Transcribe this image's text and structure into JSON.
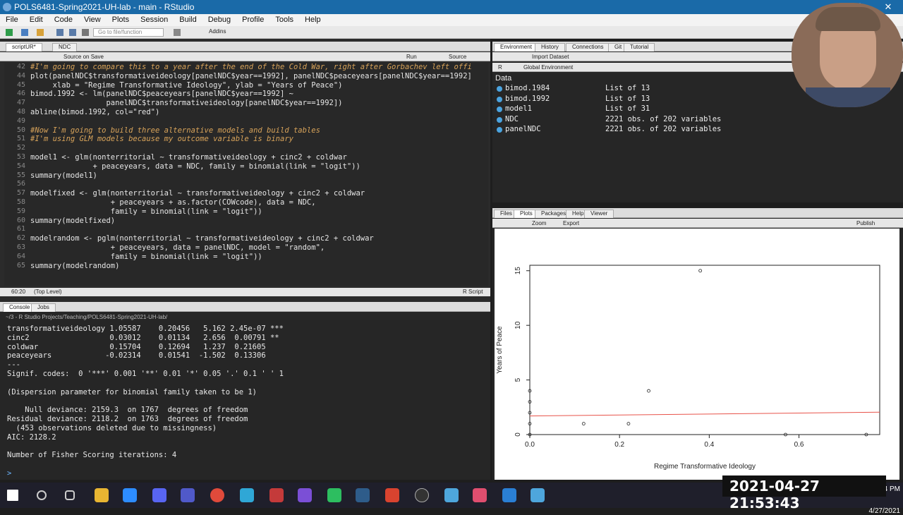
{
  "window": {
    "title": "POLS6481-Spring2021-UH-lab - main - RStudio"
  },
  "menu": [
    "File",
    "Edit",
    "Code",
    "View",
    "Plots",
    "Session",
    "Build",
    "Debug",
    "Profile",
    "Tools",
    "Help"
  ],
  "toolbar": {
    "goto_placeholder": "Go to file/function",
    "addins": "Addins"
  },
  "editor": {
    "tabs": [
      "scriptUR*",
      "NDC"
    ],
    "source_on_save": "Source on Save",
    "run": "Run",
    "source": "Source",
    "status_pos": "60:20",
    "status_scope": "(Top Level)",
    "status_type": "R Script",
    "lines": [
      {
        "n": "42",
        "text": "#I'm going to compare this to a year after the end of the Cold War, right after Gorbachev left offi",
        "comment": true
      },
      {
        "n": "44",
        "text": "plot(panelNDC$transformativeideology[panelNDC$year==1992], panelNDC$peaceyears[panelNDC$year==1992]",
        "comment": false
      },
      {
        "n": "45",
        "text": "     xlab = \"Regime Transformative Ideology\", ylab = \"Years of Peace\")",
        "comment": false
      },
      {
        "n": "46",
        "text": "bimod.1992 <- lm(panelNDC$peaceyears[panelNDC$year==1992] ~",
        "comment": false
      },
      {
        "n": "47",
        "text": "                 panelNDC$transformativeideology[panelNDC$year==1992])",
        "comment": false
      },
      {
        "n": "48",
        "text": "abline(bimod.1992, col=\"red\")",
        "comment": false
      },
      {
        "n": "49",
        "text": "",
        "comment": false
      },
      {
        "n": "50",
        "text": "#Now I'm going to build three alternative models and build tables",
        "comment": true
      },
      {
        "n": "51",
        "text": "#I'm using GLM models because my outcome variable is binary",
        "comment": true
      },
      {
        "n": "52",
        "text": "",
        "comment": false
      },
      {
        "n": "53",
        "text": "model1 <- glm(nonterritorial ~ transformativeideology + cinc2 + coldwar",
        "comment": false
      },
      {
        "n": "54",
        "text": "              + peaceyears, data = NDC, family = binomial(link = \"logit\"))",
        "comment": false
      },
      {
        "n": "55",
        "text": "summary(model1)",
        "comment": false
      },
      {
        "n": "56",
        "text": "",
        "comment": false
      },
      {
        "n": "57",
        "text": "modelfixed <- glm(nonterritorial ~ transformativeideology + cinc2 + coldwar",
        "comment": false
      },
      {
        "n": "58",
        "text": "                  + peaceyears + as.factor(COWcode), data = NDC,",
        "comment": false
      },
      {
        "n": "59",
        "text": "                  family = binomial(link = \"logit\"))",
        "comment": false
      },
      {
        "n": "60",
        "text": "summary(modelfixed)",
        "comment": false
      },
      {
        "n": "61",
        "text": "",
        "comment": false
      },
      {
        "n": "62",
        "text": "modelrandom <- pglm(nonterritorial ~ transformativeideology + cinc2 + coldwar",
        "comment": false
      },
      {
        "n": "63",
        "text": "                  + peaceyears, data = panelNDC, model = \"random\",",
        "comment": false
      },
      {
        "n": "64",
        "text": "                  family = binomial(link = \"logit\"))",
        "comment": false
      },
      {
        "n": "65",
        "text": "summary(modelrandom)",
        "comment": false
      }
    ]
  },
  "console": {
    "tabs": [
      "Console",
      "Jobs"
    ],
    "path": "~/3 - R Studio Projects/Teaching/POLS6481-Spring2021-UH-lab/",
    "lines": [
      "transformativeideology 1.05587    0.20456   5.162 2.45e-07 ***",
      "cinc2                  0.03012    0.01134   2.656  0.00791 **",
      "coldwar                0.15704    0.12694   1.237  0.21605",
      "peaceyears            -0.02314    0.01541  -1.502  0.13306",
      "---",
      "Signif. codes:  0 '***' 0.001 '**' 0.01 '*' 0.05 '.' 0.1 ' ' 1",
      "",
      "(Dispersion parameter for binomial family taken to be 1)",
      "",
      "    Null deviance: 2159.3  on 1767  degrees of freedom",
      "Residual deviance: 2118.2  on 1763  degrees of freedom",
      "  (453 observations deleted due to missingness)",
      "AIC: 2128.2",
      "",
      "Number of Fisher Scoring iterations: 4",
      "",
      ">"
    ]
  },
  "environment": {
    "tabs": [
      "Environment",
      "History",
      "Connections",
      "Git",
      "Tutorial"
    ],
    "import": "Import Dataset",
    "scope_r": "R",
    "scope": "Global Environment",
    "section": "Data",
    "rows": [
      {
        "name": "bimod.1984",
        "value": "List of  13"
      },
      {
        "name": "bimod.1992",
        "value": "List of  13"
      },
      {
        "name": "model1",
        "value": "List of  31"
      },
      {
        "name": "NDC",
        "value": "2221 obs. of 202 variables"
      },
      {
        "name": "panelNDC",
        "value": "2221 obs. of 202 variables"
      }
    ]
  },
  "plots": {
    "tabs": [
      "Files",
      "Plots",
      "Packages",
      "Help",
      "Viewer"
    ],
    "zoom": "Zoom",
    "export": "Export",
    "publish": "Publish"
  },
  "chart_data": {
    "type": "scatter",
    "xlabel": "Regime Transformative Ideology",
    "ylabel": "Years of Peace",
    "xlim": [
      0,
      0.78
    ],
    "ylim": [
      0,
      15.5
    ],
    "xticks": [
      "0.0",
      "0.2",
      "0.4",
      "0.6"
    ],
    "yticks": [
      "0",
      "5",
      "10",
      "15"
    ],
    "points": [
      {
        "x": 0.0,
        "y": 0
      },
      {
        "x": 0.0,
        "y": 1
      },
      {
        "x": 0.0,
        "y": 2
      },
      {
        "x": 0.0,
        "y": 3
      },
      {
        "x": 0.0,
        "y": 4
      },
      {
        "x": 0.12,
        "y": 1
      },
      {
        "x": 0.22,
        "y": 1
      },
      {
        "x": 0.265,
        "y": 4
      },
      {
        "x": 0.38,
        "y": 15
      },
      {
        "x": 0.57,
        "y": 0
      },
      {
        "x": 0.75,
        "y": 0
      }
    ],
    "fit_line": {
      "x": [
        0.0,
        0.78
      ],
      "y": [
        1.7,
        2.05
      ],
      "color": "#e8534a"
    }
  },
  "taskbar": {
    "time": "5:54 PM",
    "date": "4/27/2021"
  },
  "overlay": {
    "timestamp": "2021-04-27 21:53:43"
  },
  "colors": {
    "titlebar": "#1a6aa8",
    "comment": "#d9a45a",
    "env_dot": "#4aa3df",
    "fit_line": "#e8534a"
  }
}
